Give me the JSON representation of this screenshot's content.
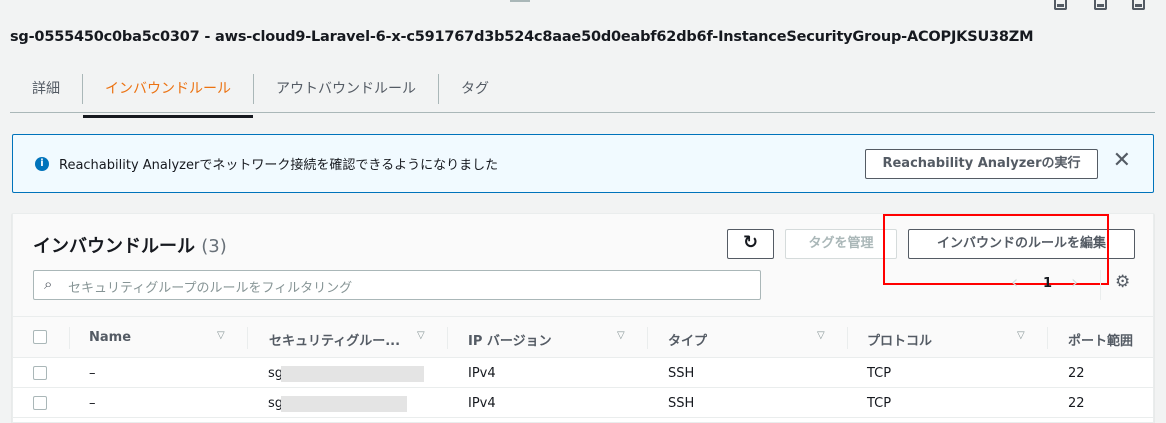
{
  "title": "sg-0555450c0ba5c0307 - aws-cloud9-Laravel-6-x-c591767d3b524c8aae50d0eabf62db6f-InstanceSecurityGroup-ACOPJKSU38ZM",
  "tabs": [
    "詳細",
    "インバウンドルール",
    "アウトバウンドルール",
    "タグ"
  ],
  "banner": {
    "text": "Reachability Analyzerでネットワーク接続を確認できるようになりました",
    "button": "Reachability Analyzerの実行"
  },
  "panel": {
    "title": "インバウンドルール",
    "count": "(3)",
    "manage_tags": "タグを管理",
    "edit_rules": "インバウンドのルールを編集",
    "search_placeholder": "セキュリティグループのルールをフィルタリング",
    "page": "1"
  },
  "columns": [
    "Name",
    "セキュリティグルー...",
    "IP バージョン",
    "タイプ",
    "プロトコル",
    "ポート範囲"
  ],
  "rows": [
    {
      "name": "–",
      "sg": "sg",
      "ip": "IPv4",
      "type": "SSH",
      "protocol": "TCP",
      "port": "22"
    },
    {
      "name": "–",
      "sg": "sg",
      "ip": "IPv4",
      "type": "SSH",
      "protocol": "TCP",
      "port": "22"
    }
  ],
  "colors": {
    "accent": "#ec7211",
    "info": "#0073bb",
    "highlight": "#ff0000"
  }
}
